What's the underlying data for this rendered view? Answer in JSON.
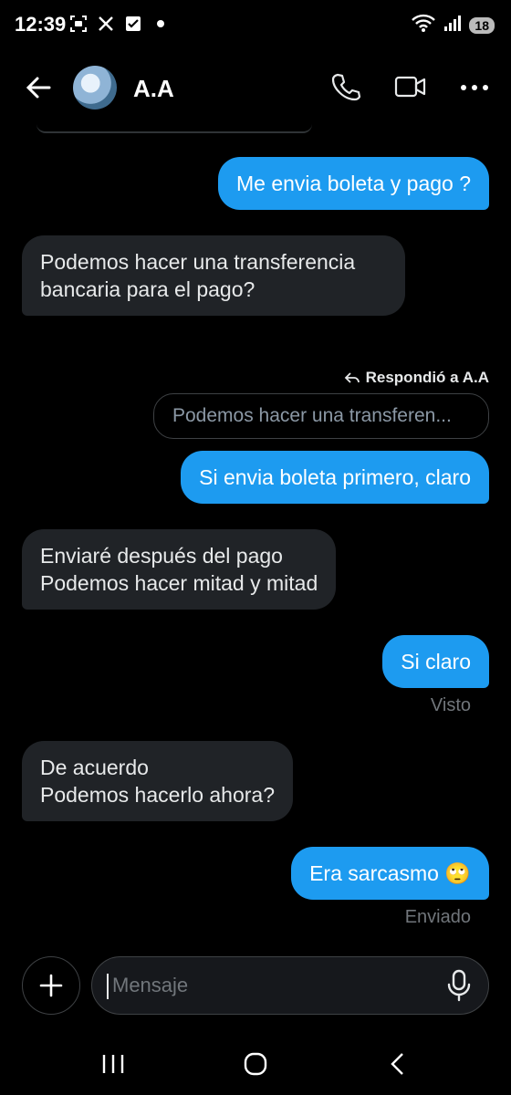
{
  "status_bar": {
    "time": "12:39",
    "battery": "18",
    "icons": [
      "screenshot-icon",
      "x-logo-icon",
      "check-box-icon",
      "dot-icon",
      "wifi-icon",
      "signal-icon",
      "battery-icon"
    ]
  },
  "header": {
    "contact_name": "A.A",
    "icons": [
      "back-arrow-icon",
      "avatar",
      "phone-icon",
      "video-icon",
      "more-icon"
    ]
  },
  "messages": [
    {
      "dir": "out",
      "text": "Me envia boleta y pago ?"
    },
    {
      "dir": "in",
      "text": "Podemos hacer una transferencia bancaria para el pago?"
    },
    {
      "dir": "out",
      "reply_label": "Respondió a A.A",
      "quote": "Podemos hacer una transferen...",
      "text": "Si envia boleta primero, claro"
    },
    {
      "dir": "in",
      "line1": "Enviaré después del pago",
      "line2": "Podemos hacer mitad y mitad"
    },
    {
      "dir": "out",
      "text": "Si claro",
      "status": "Visto"
    },
    {
      "dir": "in",
      "line1": "De acuerdo",
      "line2": "Podemos hacerlo ahora?"
    },
    {
      "dir": "out",
      "text": "Era sarcasmo 🙄",
      "status": "Enviado"
    }
  ],
  "composer": {
    "placeholder": "Mensaje"
  },
  "colors": {
    "outgoing_bubble": "#1d9bf0",
    "incoming_bubble": "#202327",
    "background": "#000000"
  }
}
